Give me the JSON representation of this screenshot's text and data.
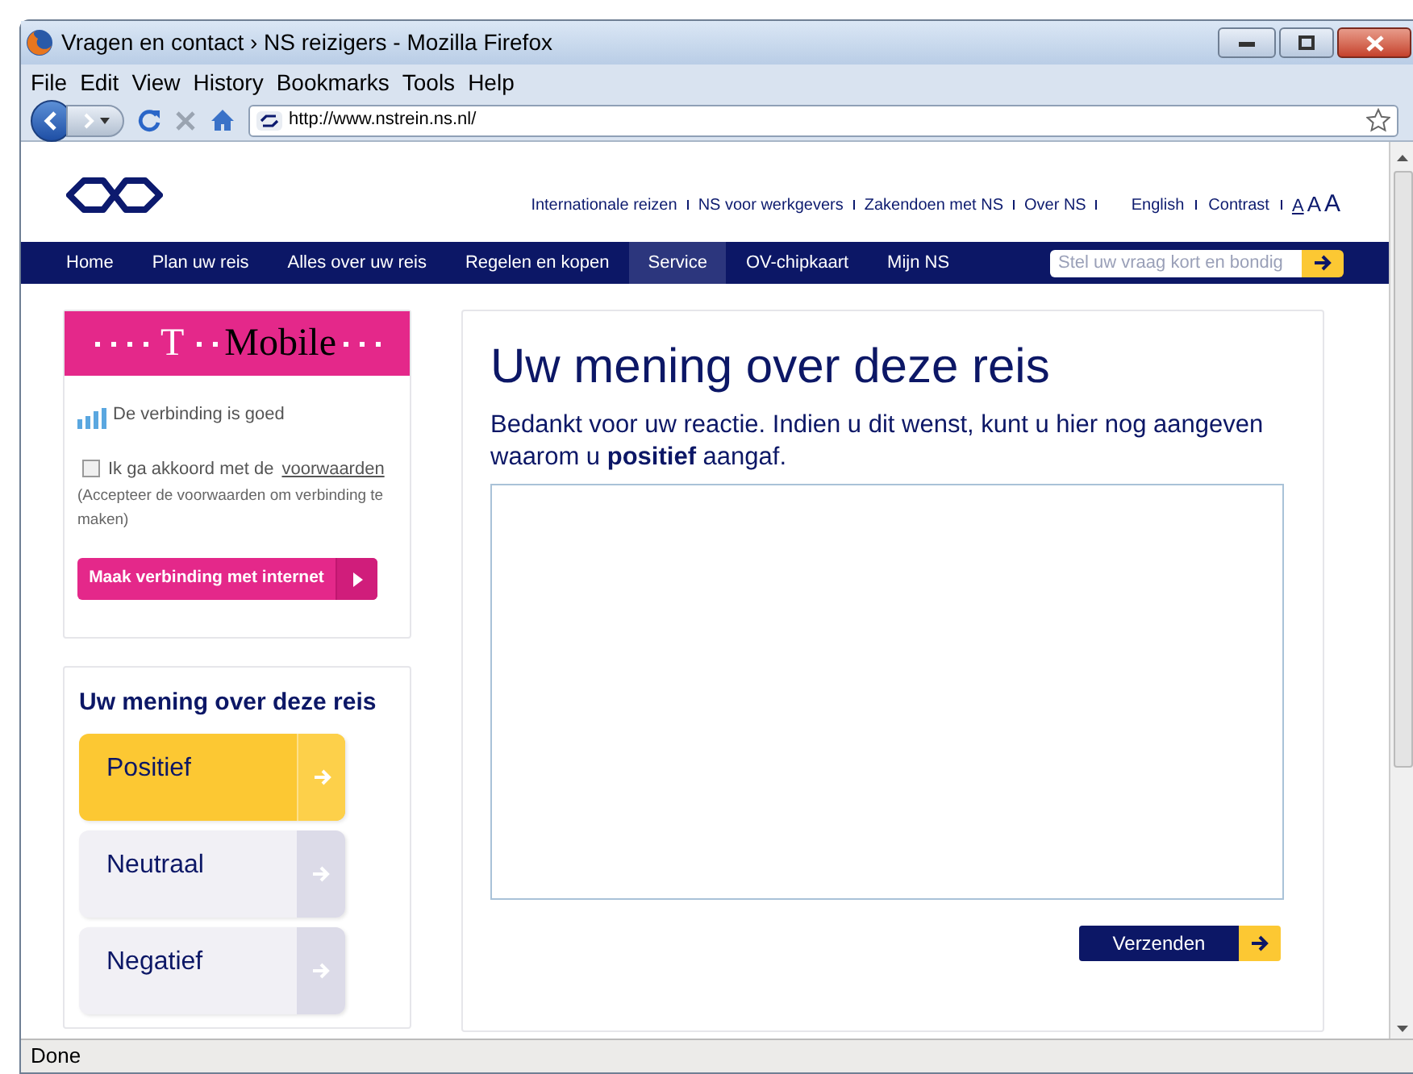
{
  "window": {
    "title": "Vragen en contact › NS reizigers - Mozilla Firefox"
  },
  "menu": [
    "File",
    "Edit",
    "View",
    "History",
    "Bookmarks",
    "Tools",
    "Help"
  ],
  "address": {
    "url": "http://www.nstrein.ns.nl/"
  },
  "top_links": [
    "Internationale reizen",
    "NS voor werkgevers",
    "Zakendoen met NS",
    "Over NS"
  ],
  "lang_links": [
    "English",
    "Contrast"
  ],
  "font_sizes": [
    "A",
    "A",
    "A"
  ],
  "nav": [
    {
      "label": "Home",
      "selected": false
    },
    {
      "label": "Plan uw reis",
      "selected": false
    },
    {
      "label": "Alles over uw reis",
      "selected": false
    },
    {
      "label": "Regelen en kopen",
      "selected": false
    },
    {
      "label": "Service",
      "selected": true
    },
    {
      "label": "OV-chipkaart",
      "selected": false
    },
    {
      "label": "Mijn NS",
      "selected": false
    }
  ],
  "search": {
    "placeholder": "Stel uw vraag kort en bondig"
  },
  "tmobile": {
    "brand_letter": "T",
    "brand_name": "Mobile",
    "status": "De verbinding is goed",
    "agree": {
      "label": "Ik ga akkoord met de",
      "link": "voorwaarden",
      "checked": false
    },
    "note": "(Accepteer de voorwaarden om verbinding te maken)",
    "button": "Maak verbinding met internet"
  },
  "rating": {
    "title": "Uw mening over deze reis",
    "options": [
      {
        "label": "Positief",
        "selected": true
      },
      {
        "label": "Neutraal",
        "selected": false
      },
      {
        "label": "Negatief",
        "selected": false
      }
    ]
  },
  "main": {
    "title": "Uw mening over deze reis",
    "text": "Bedankt voor uw reactie. Indien u dit wenst, kunt u hier nog aangeven waarom u **positief** aangaf.",
    "submit": "Verzenden"
  },
  "status_bar": "Done"
}
